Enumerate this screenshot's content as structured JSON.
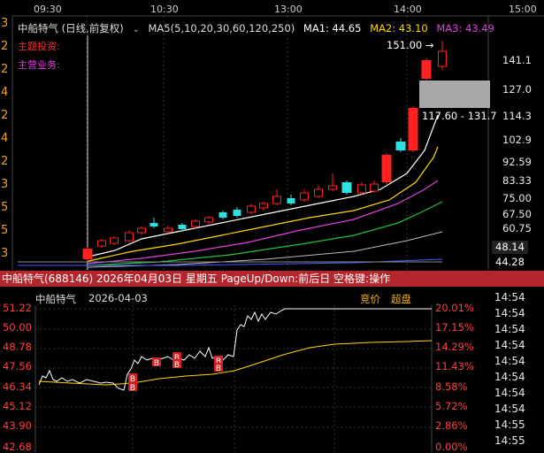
{
  "left_strip_digits": [
    "3",
    "2",
    "2",
    "4",
    "2",
    "4",
    "2",
    "3",
    "5",
    "5",
    "3"
  ],
  "top_axis_times": [
    "09:30",
    "10:30",
    "13:00",
    "14:00",
    "15:00"
  ],
  "header": {
    "title": "中船特气 (日线,前复权)",
    "ma_params": "MA5(5,10,20,30,60,120,250)",
    "ma1": "MA1: 44.65",
    "ma2": "MA2: 43.10",
    "ma3": "MA3: 43.49",
    "ma1_color": "#ffffff",
    "ma2_color": "#ffd700",
    "ma3_color": "#e040e0"
  },
  "side_labels": {
    "theme": "主题投资:",
    "business": "主营业务:"
  },
  "high_marker": "151.00",
  "range_label": "117.60 - 131.7",
  "price_axis": [
    "141.1",
    "127.0",
    "114.3",
    "102.9",
    "92.59",
    "83.33",
    "75.00",
    "67.50",
    "60.75"
  ],
  "price_tag_a": "48.14",
  "price_tag_b": "44.28",
  "status_bar": "中船特气(688146)  2026年04月03日 星期五  PageUp/Down:前后日  空格键:操作",
  "intraday": {
    "title": "中船特气",
    "date": "2026-04-03",
    "mode_bid": "竞价",
    "mode_big": "超盘",
    "price_axis": [
      "51.22",
      "50.00",
      "48.78",
      "47.56",
      "46.34",
      "45.12",
      "43.90",
      "42.68"
    ],
    "pct_axis": [
      "20.01%",
      "17.15%",
      "14.29%",
      "11.43%",
      "8.58%",
      "5.72%",
      "2.86%",
      "0.00%"
    ]
  },
  "time_list": [
    "14:54",
    "14:54",
    "14:54",
    "14:54",
    "14:54",
    "14:54",
    "14:54",
    "14:54",
    "14:55",
    "14:55"
  ],
  "colors": {
    "up": "#ff2020",
    "down": "#30e0e0",
    "ma_white": "#ffffff",
    "ma_yellow": "#ffd700",
    "ma_magenta": "#e040e0",
    "ma_green": "#20c040"
  }
}
